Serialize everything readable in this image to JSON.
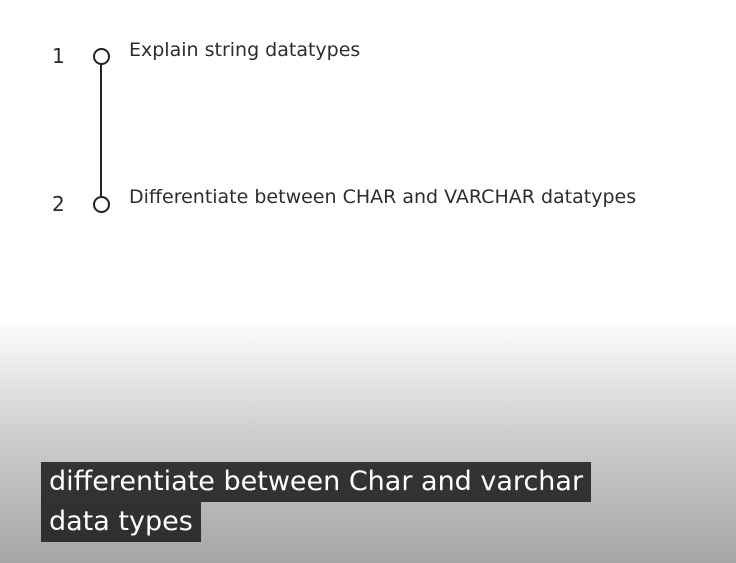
{
  "steps": [
    {
      "number": "1",
      "label": "Explain string datatypes"
    },
    {
      "number": "2",
      "label": "Differentiate between CHAR and VARCHAR datatypes"
    }
  ],
  "caption": {
    "line1": "differentiate between Char and varchar",
    "line2": "data types"
  },
  "colors": {
    "text": "#2d2d2d",
    "caption_bg": "#1a1a1a",
    "caption_text": "#ffffff"
  }
}
